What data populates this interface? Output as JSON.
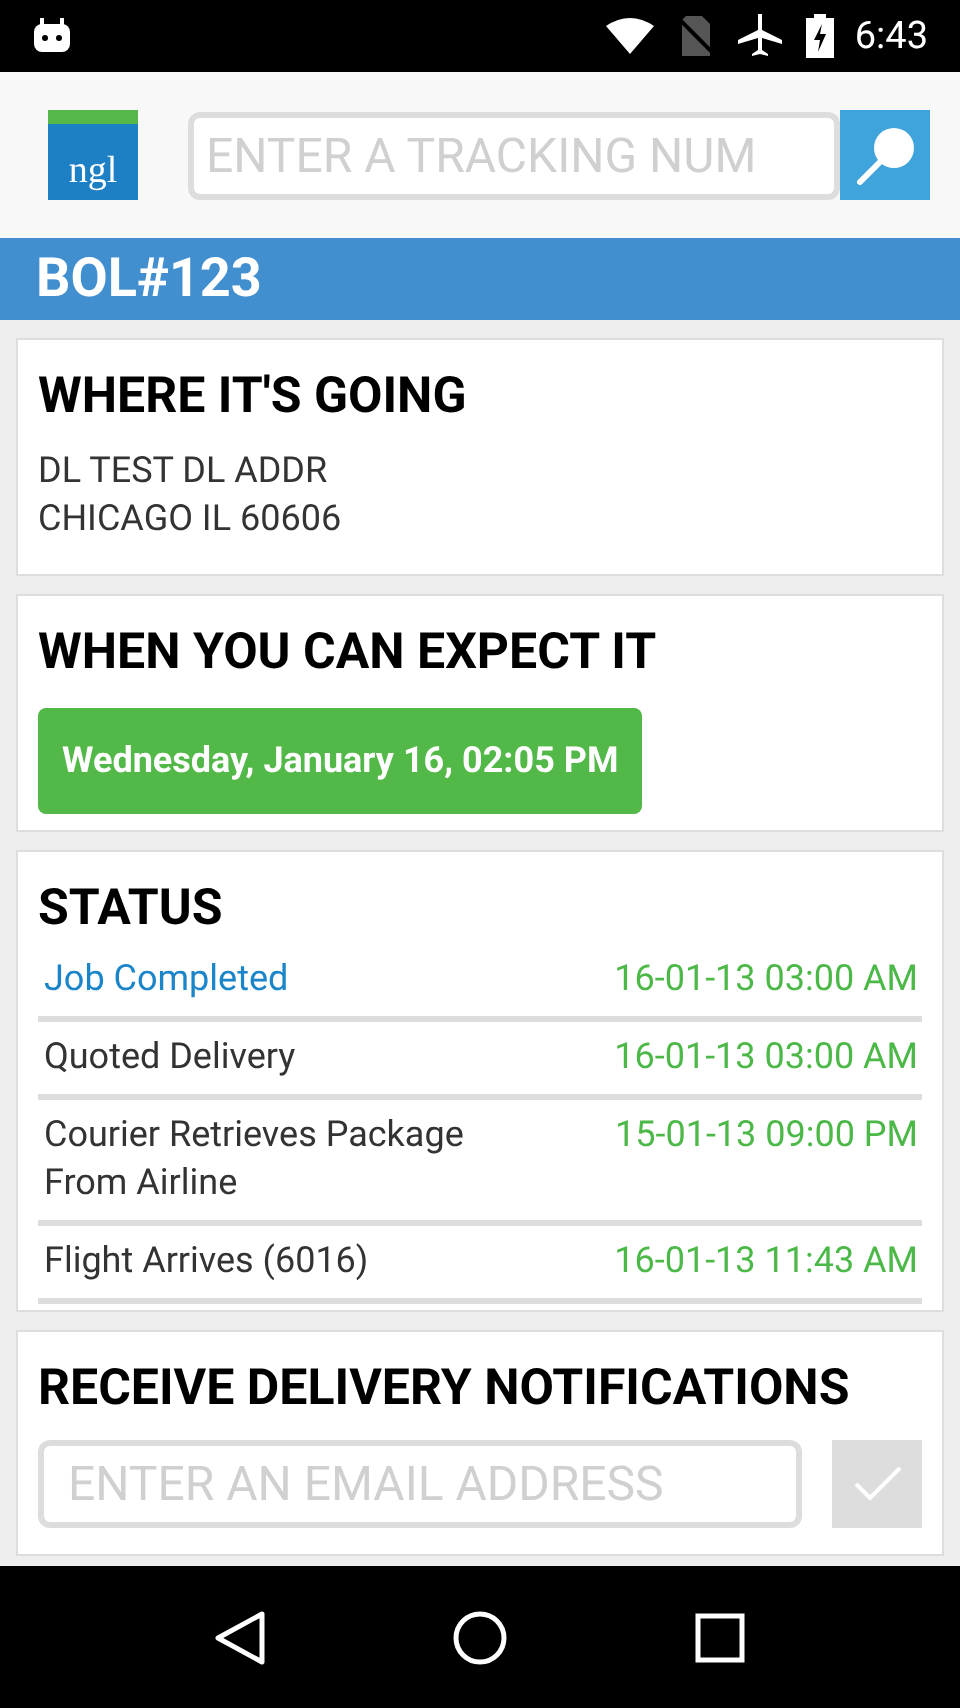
{
  "status_bar": {
    "time": "6:43"
  },
  "header": {
    "logo": "ngl",
    "search": {
      "placeholder": "ENTER A TRACKING NUM"
    }
  },
  "title_bar": {
    "title": "BOL#123"
  },
  "destination": {
    "heading": "WHERE IT'S GOING",
    "address_lines": [
      "DL TEST DL ADDR",
      "CHICAGO IL 60606"
    ]
  },
  "expected": {
    "heading": "WHEN YOU CAN EXPECT IT",
    "date": "Wednesday, January 16, 02:05 PM"
  },
  "status": {
    "heading": "STATUS",
    "events": [
      {
        "label": "Job Completed",
        "time": "16-01-13 03:00 AM",
        "current": true
      },
      {
        "label": "Quoted Delivery",
        "time": "16-01-13 03:00 AM",
        "current": false
      },
      {
        "label": "Courier Retrieves Package From Airline",
        "time": "15-01-13 09:00 PM",
        "current": false
      },
      {
        "label": "Flight Arrives (6016)",
        "time": "16-01-13 11:43 AM",
        "current": false
      }
    ]
  },
  "notifications": {
    "heading": "RECEIVE DELIVERY NOTIFICATIONS",
    "email": {
      "placeholder": "ENTER AN EMAIL ADDRESS"
    },
    "submit": {
      "disabled": true
    }
  }
}
